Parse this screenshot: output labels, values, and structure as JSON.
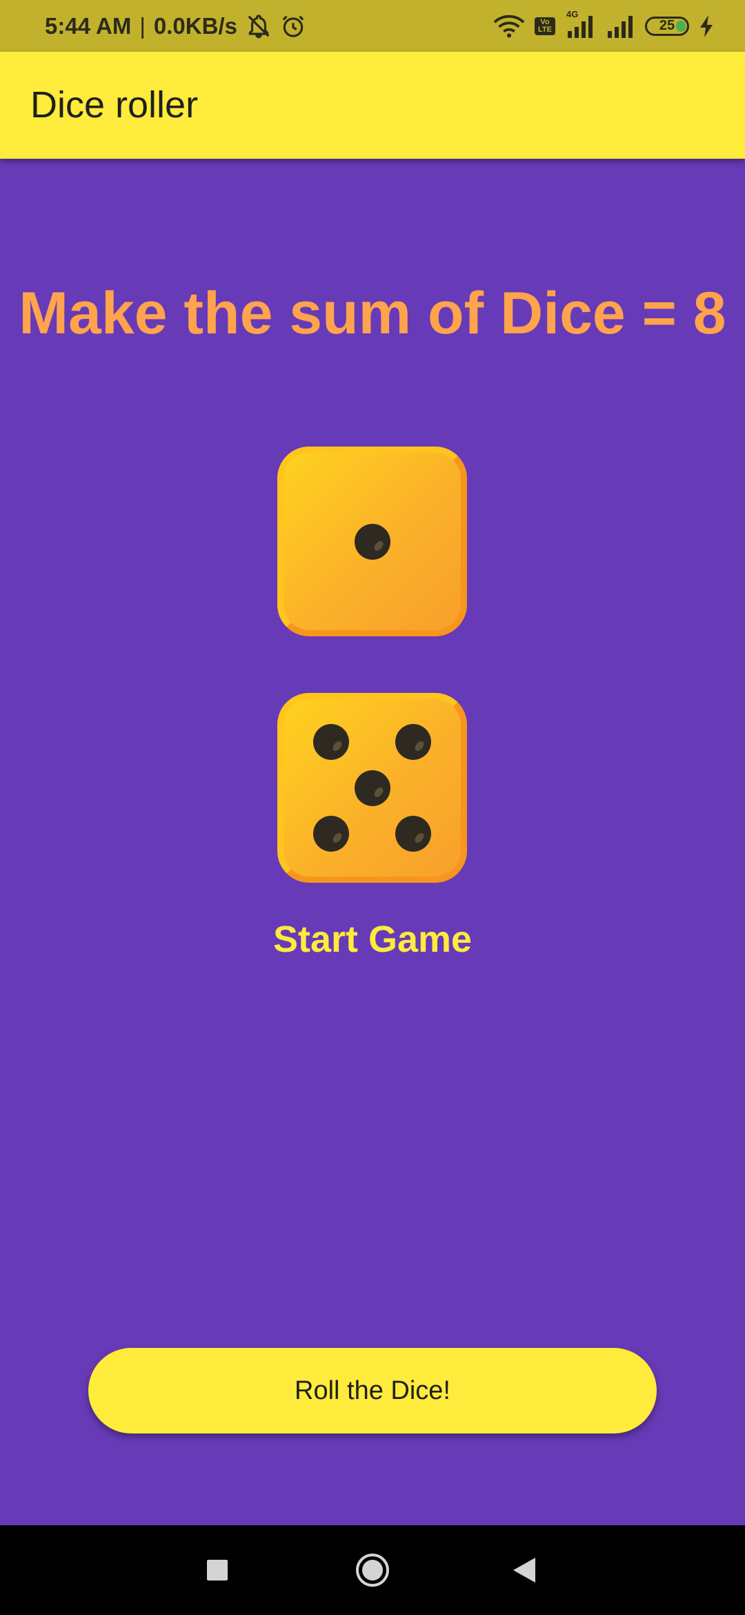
{
  "status_bar": {
    "time": "5:44 AM",
    "separator": "|",
    "network_speed": "0.0KB/s",
    "left_icons": [
      "mute-notifications-icon",
      "alarm-icon"
    ],
    "right_icons": [
      "wifi-icon",
      "volte-icon",
      "signal-4g-icon",
      "signal-icon",
      "battery-icon",
      "charging-icon"
    ],
    "volte_label": "Vo LTE",
    "network_type": "4G",
    "battery_level": "25"
  },
  "app_bar": {
    "title": "Dice roller"
  },
  "main": {
    "headline": "Make the sum of Dice = 8",
    "dice": [
      {
        "value": 1
      },
      {
        "value": 5
      }
    ],
    "status_text": "Start Game",
    "roll_button_label": "Roll the Dice!"
  },
  "nav_bar": {
    "buttons": [
      "recents-icon",
      "home-icon",
      "back-icon"
    ]
  },
  "colors": {
    "background": "#673ab7",
    "app_bar": "#ffeb3b",
    "status_bar": "#c1b12c",
    "headline": "#ffa34d",
    "status_text": "#ffeb3b",
    "die_face": "#fbb129",
    "pip": "#2e2a21"
  }
}
